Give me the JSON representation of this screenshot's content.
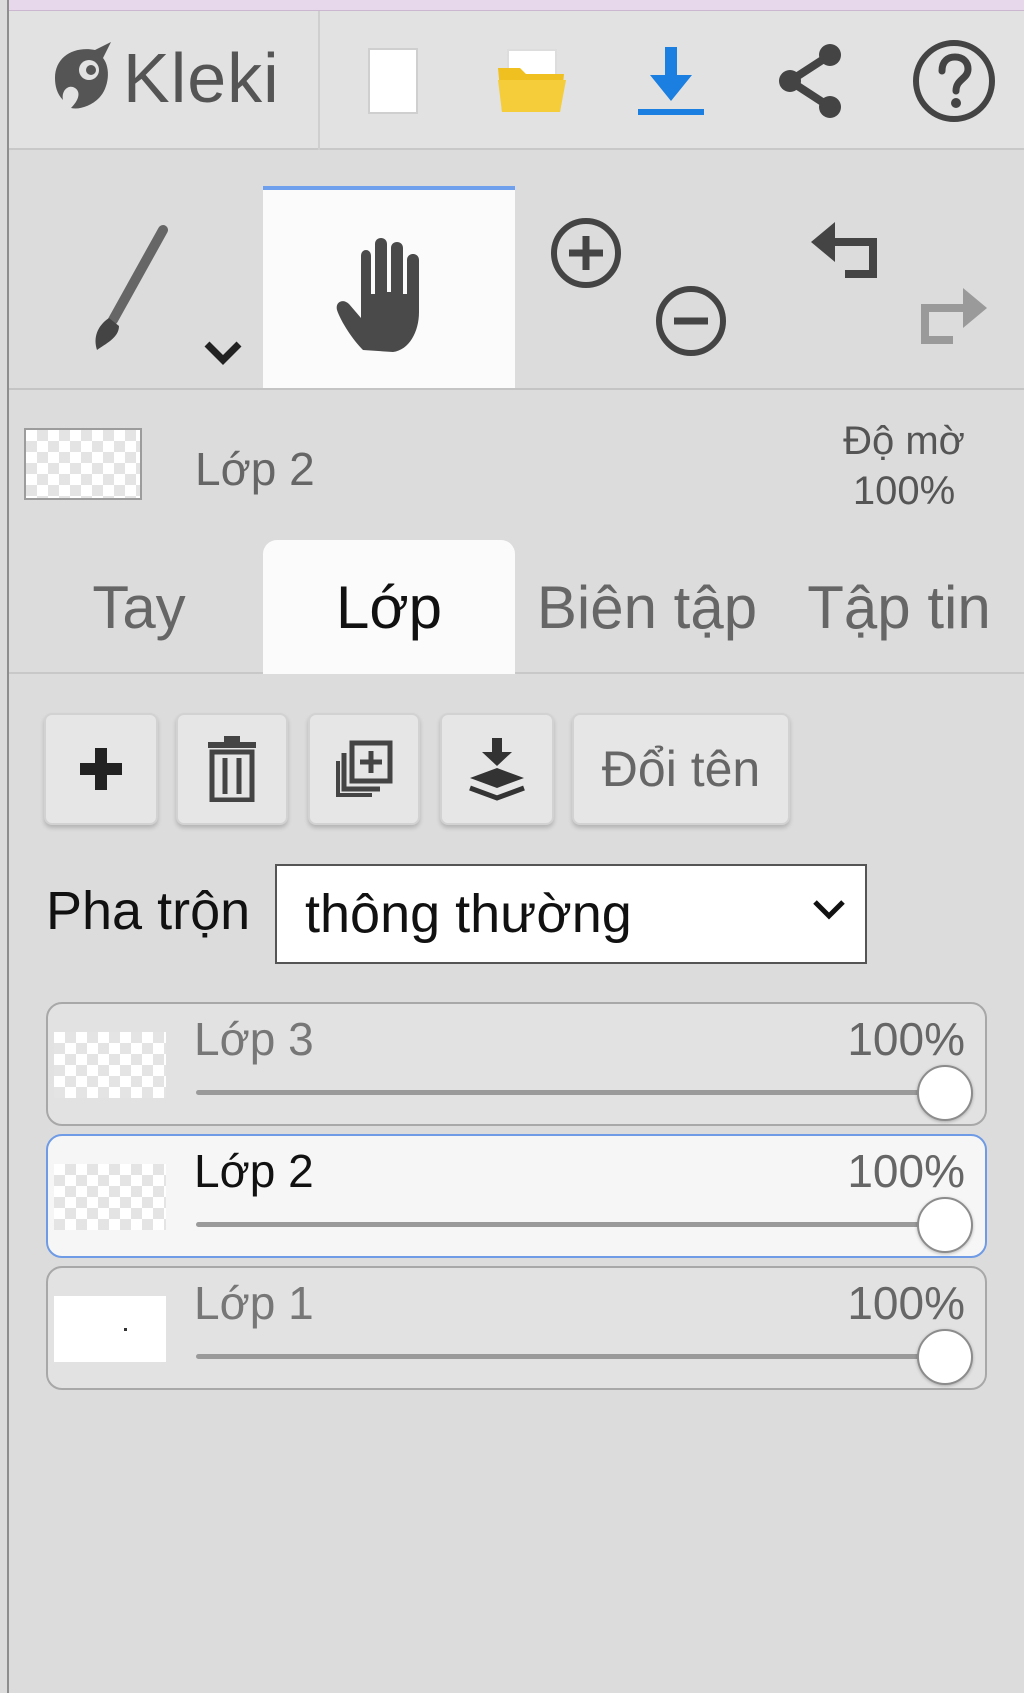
{
  "app": {
    "name": "Kleki"
  },
  "header": {
    "icons": [
      "new-image-icon",
      "open-folder-icon",
      "download-icon",
      "share-icon",
      "help-icon"
    ]
  },
  "toolbar": {
    "tools": [
      "brush-icon",
      "hand-icon",
      "zoom-in-icon",
      "zoom-out-icon",
      "undo-icon",
      "redo-icon"
    ],
    "active_tool": "hand"
  },
  "current_layer": {
    "name": "Lớp 2",
    "opacity_label": "Độ mờ",
    "opacity_value": "100%"
  },
  "tabs": [
    {
      "label": "Tay",
      "active": false
    },
    {
      "label": "Lớp",
      "active": true
    },
    {
      "label": "Biên tập",
      "active": false
    },
    {
      "label": "Tập tin",
      "active": false
    }
  ],
  "layer_panel": {
    "buttons": {
      "rename_label": "Đổi tên"
    },
    "blend_label": "Pha trộn",
    "blend_value": "thông thường",
    "layers": [
      {
        "name": "Lớp 3",
        "opacity": "100%",
        "opacity_fraction": 1.0,
        "selected": false
      },
      {
        "name": "Lớp 2",
        "opacity": "100%",
        "opacity_fraction": 1.0,
        "selected": true
      },
      {
        "name": "Lớp 1",
        "opacity": "100%",
        "opacity_fraction": 1.0,
        "selected": false
      }
    ]
  },
  "colors": {
    "accent": "#1a7fe0",
    "folder": "#f0c020",
    "selection_border": "#6f9be6",
    "panel_bg": "#dcdcdc"
  }
}
